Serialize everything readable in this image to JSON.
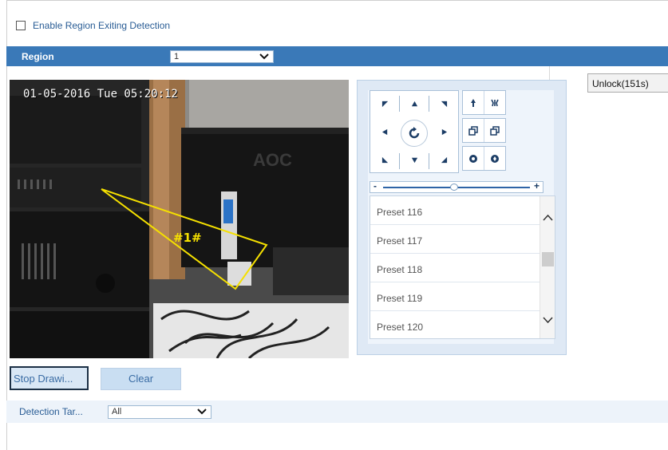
{
  "enable": {
    "label": "Enable Region Exiting Detection",
    "checked": false
  },
  "region": {
    "label": "Region",
    "selected": "1"
  },
  "unlock_button": "Unlock(151s)",
  "video": {
    "timestamp": "01-05-2016 Tue 05:20:12",
    "region_tag": "#1#",
    "monitor_brand": "AOC"
  },
  "ptz": {
    "directions": [
      "up-left",
      "up",
      "up-right",
      "left",
      "auto",
      "right",
      "down-left",
      "down",
      "down-right"
    ],
    "controls": [
      "zoom-in-icon",
      "zoom-out-icon",
      "focus-near-icon",
      "focus-far-icon",
      "iris-open-icon",
      "iris-close-icon"
    ],
    "speed_level": 0.48,
    "presets": [
      "Preset 116",
      "Preset 117",
      "Preset 118",
      "Preset 119",
      "Preset 120"
    ]
  },
  "buttons": {
    "stop_drawing": "Stop Drawi...",
    "clear": "Clear"
  },
  "detection": {
    "label": "Detection Tar...",
    "selected": "All"
  },
  "colors": {
    "accent": "#3a79b8",
    "region_line": "#f5e000",
    "panel": "#dfe9f5"
  }
}
